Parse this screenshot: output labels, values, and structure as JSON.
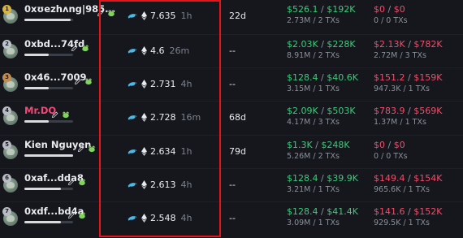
{
  "rows": [
    {
      "rank": "1",
      "name": "0xʊezhʌng|985...",
      "balance": "7.635",
      "age": "1h",
      "hold": "22d",
      "buy": "$526.1",
      "buy_total": "$192K",
      "buy_sub": "2.73M / 2 TXs",
      "sell": "$0",
      "sell_total": "$0",
      "sell_sub": "0 / 0 TXs",
      "progress": 0.95
    },
    {
      "rank": "2",
      "name": "0xbd...74fd",
      "balance": "4.6",
      "age": "26m",
      "hold": "--",
      "buy": "$2.03K",
      "buy_total": "$228K",
      "buy_sub": "8.91M / 2 TXs",
      "sell": "$2.13K",
      "sell_total": "$782K",
      "sell_sub": "2.72M / 3 TXs",
      "progress": 0.5
    },
    {
      "rank": "3",
      "name": "0x46...7009",
      "balance": "2.731",
      "age": "4h",
      "hold": "--",
      "buy": "$128.4",
      "buy_total": "$40.6K",
      "buy_sub": "3.15M / 1 TXs",
      "sell": "$151.2",
      "sell_total": "$159K",
      "sell_sub": "947.3K / 1 TXs",
      "progress": 0.5
    },
    {
      "rank": "4",
      "name": "Mr.DQ",
      "balance": "2.728",
      "age": "16m",
      "hold": "68d",
      "buy": "$2.09K",
      "buy_total": "$503K",
      "buy_sub": "4.17M / 3 TXs",
      "sell": "$783.9",
      "sell_total": "$569K",
      "sell_sub": "1.37M / 1 TXs",
      "progress": 0.5
    },
    {
      "rank": "5",
      "name": "Kien Nguyen",
      "balance": "2.634",
      "age": "1h",
      "hold": "79d",
      "buy": "$1.3K",
      "buy_total": "$248K",
      "buy_sub": "5.26M / 2 TXs",
      "sell": "$0",
      "sell_total": "$0",
      "sell_sub": "0 / 0 TXs",
      "progress": 1.0
    },
    {
      "rank": "6",
      "name": "0xaf...dda8",
      "balance": "2.613",
      "age": "4h",
      "hold": "--",
      "buy": "$128.4",
      "buy_total": "$39.9K",
      "buy_sub": "3.21M / 1 TXs",
      "sell": "$149.4",
      "sell_total": "$154K",
      "sell_sub": "965.6K / 1 TXs",
      "progress": 0.75
    },
    {
      "rank": "7",
      "name": "0xdf...bd4a",
      "balance": "2.548",
      "age": "4h",
      "hold": "--",
      "buy": "$128.4",
      "buy_total": "$41.4K",
      "buy_sub": "3.09M / 1 TXs",
      "sell": "$141.6",
      "sell_total": "$152K",
      "sell_sub": "929.5K / 1 TXs",
      "progress": 0.75
    }
  ],
  "colors": {
    "profit": "#3ccb78",
    "loss": "#ef4e6a",
    "highlight": "#e8141b"
  },
  "icons": {
    "edit": "pencil-icon",
    "tag": "frog-icon",
    "balance_source": "dolphin-icon",
    "token": "eth-icon"
  }
}
